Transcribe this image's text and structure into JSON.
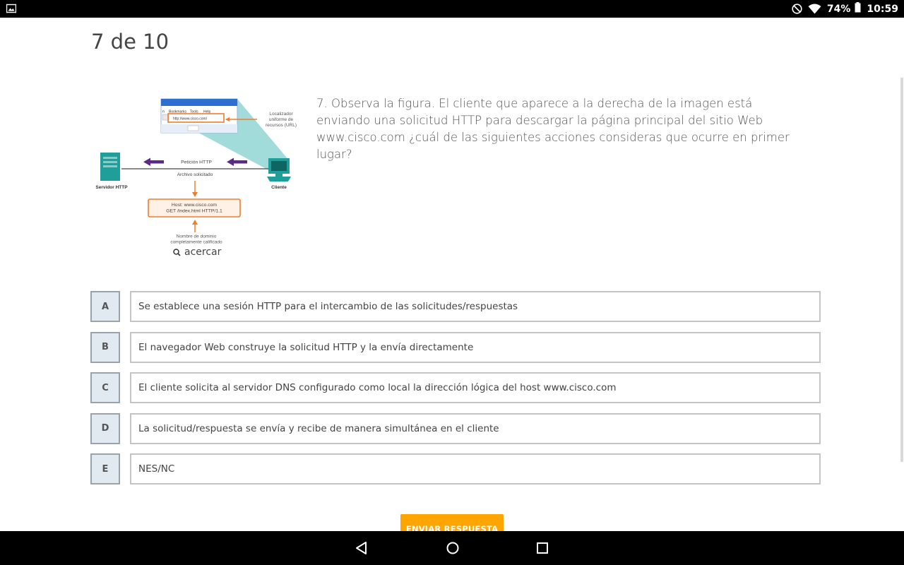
{
  "status_bar": {
    "battery_percent": "74%",
    "time": "10:59",
    "icons": [
      "gallery-icon",
      "do-not-disturb-icon",
      "wifi-icon",
      "battery-icon"
    ]
  },
  "page_counter": "7 de 10",
  "figure": {
    "menu_items": [
      "Bookmarks",
      "Tools",
      "Help"
    ],
    "url": "http://www.cisco.com/",
    "url_callout": [
      "Localizador",
      "uniforme de",
      "recursos (URL)"
    ],
    "request_label": "Petición HTTP",
    "file_label": "Archivo solicitado",
    "server_label": "Servidor HTTP",
    "client_label": "Cliente",
    "request_box": [
      "Host: www.cisco.com",
      "GET /index.html HTTP/1.1"
    ],
    "fqdn_label": [
      "Nombre de dominio",
      "completamente calificado"
    ],
    "zoom_label": "acercar"
  },
  "question": "7. Observa la figura. El cliente que aparece a la derecha de la imagen está enviando una solicitud HTTP para descargar la página principal del sitio Web www.cisco.com ¿cuál de las siguientes acciones consideras que ocurre en primer lugar?",
  "options": [
    {
      "letter": "A",
      "text": "Se establece una sesión HTTP para el intercambio de las solicitudes/respuestas"
    },
    {
      "letter": "B",
      "text": "El navegador Web construye la solicitud HTTP y la envía directamente"
    },
    {
      "letter": "C",
      "text": "El cliente solicita al servidor DNS configurado como local la dirección lógica del host www.cisco.com"
    },
    {
      "letter": "D",
      "text": "La solicitud/respuesta se envía y recibe de manera simultánea en el cliente"
    },
    {
      "letter": "E",
      "text": "NES/NC"
    }
  ],
  "submit_label": "ENVIAR RESPUESTA",
  "colors": {
    "accent": "#ffa500",
    "figure_orange": "#f07d2e",
    "figure_purple": "#5b2a86",
    "figure_teal": "#1f9e9a",
    "option_letter_bg": "#e1e9f1"
  },
  "nav_icons": [
    "back-icon",
    "home-icon",
    "recents-icon"
  ]
}
